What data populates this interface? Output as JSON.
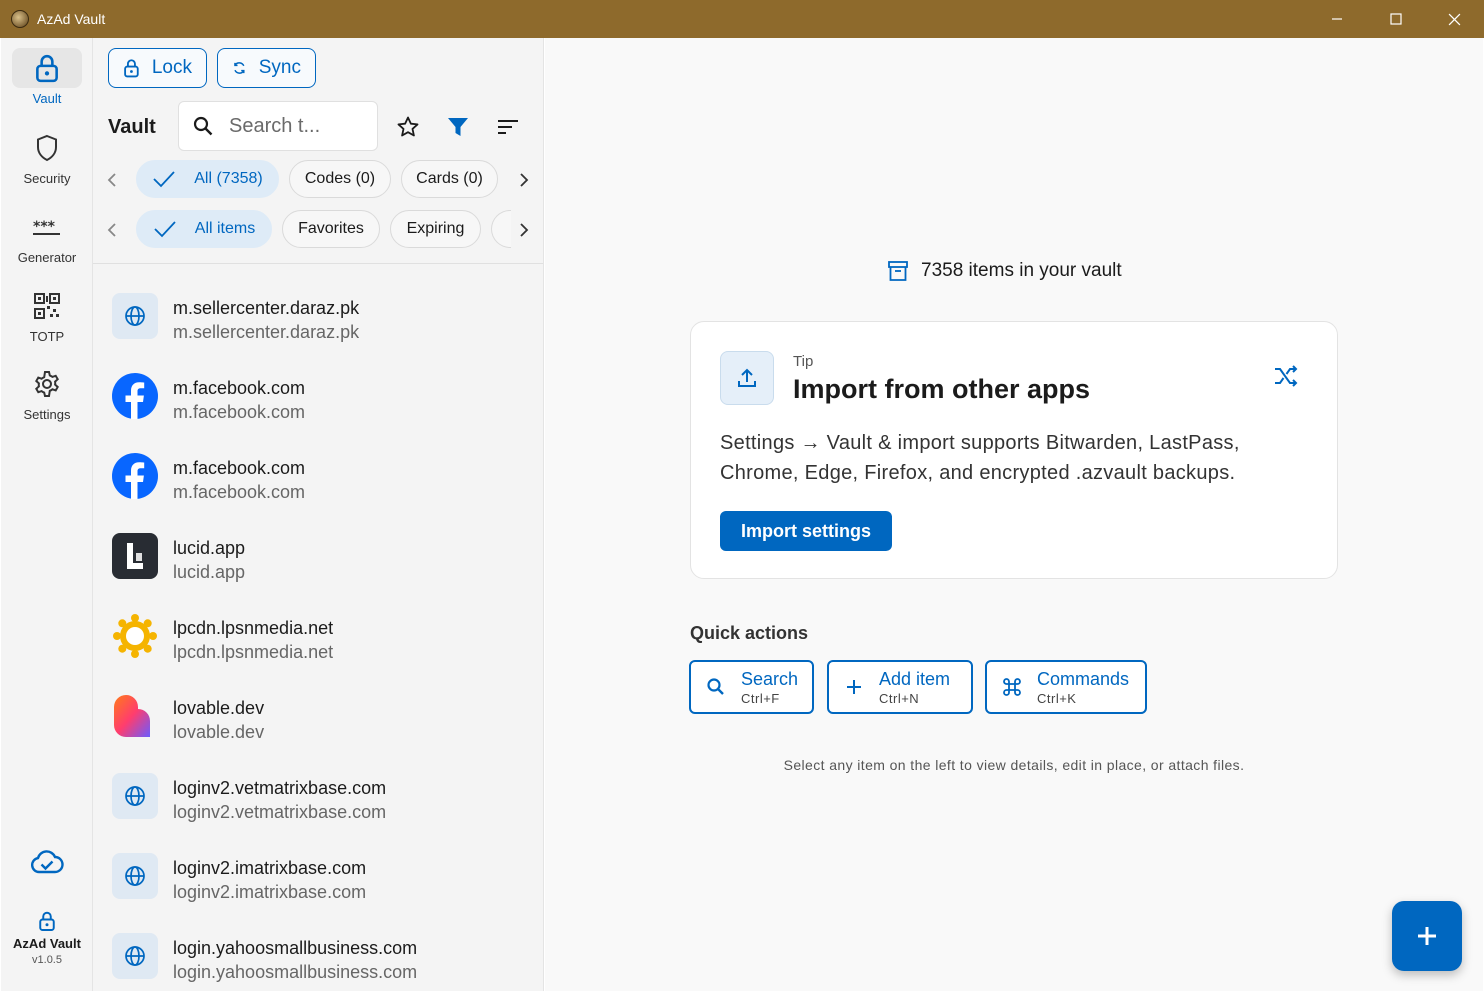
{
  "window": {
    "title": "AzAd Vault"
  },
  "rail": {
    "items": [
      {
        "label": "Vault",
        "icon": "lock-icon",
        "active": true
      },
      {
        "label": "Security",
        "icon": "shield-icon"
      },
      {
        "label": "Generator",
        "icon": "asterisks-icon"
      },
      {
        "label": "TOTP",
        "icon": "qr-code-icon"
      },
      {
        "label": "Settings",
        "icon": "gear-icon"
      }
    ],
    "brand_name": "AzAd Vault",
    "version": "v1.0.5"
  },
  "toolbar": {
    "lock_label": "Lock",
    "sync_label": "Sync"
  },
  "list": {
    "title": "Vault",
    "search_placeholder": "Search t...",
    "type_filters": [
      "All (7358)",
      "Codes (0)",
      "Cards (0)"
    ],
    "view_filters": [
      "All items",
      "Favorites",
      "Expiring"
    ],
    "entries": [
      {
        "name": "m.sellercenter.daraz.pk",
        "sub": "m.sellercenter.daraz.pk",
        "icon": "globe"
      },
      {
        "name": "m.facebook.com",
        "sub": "m.facebook.com",
        "icon": "facebook"
      },
      {
        "name": "m.facebook.com",
        "sub": "m.facebook.com",
        "icon": "facebook"
      },
      {
        "name": "lucid.app",
        "sub": "lucid.app",
        "icon": "lucid"
      },
      {
        "name": "lpcdn.lpsnmedia.net",
        "sub": "lpcdn.lpsnmedia.net",
        "icon": "sun"
      },
      {
        "name": "lovable.dev",
        "sub": "lovable.dev",
        "icon": "heart"
      },
      {
        "name": "loginv2.vetmatrixbase.com",
        "sub": "loginv2.vetmatrixbase.com",
        "icon": "globe"
      },
      {
        "name": "loginv2.imatrixbase.com",
        "sub": "loginv2.imatrixbase.com",
        "icon": "globe"
      },
      {
        "name": "login.yahoosmallbusiness.com",
        "sub": "login.yahoosmallbusiness.com",
        "icon": "globe"
      }
    ]
  },
  "detail": {
    "count_text": "7358 items in your vault",
    "tip": {
      "label": "Tip",
      "title": "Import from other apps",
      "body": "Settings → Vault & import supports Bitwarden, LastPass, Chrome, Edge, Firefox, and encrypted .azvault backups.",
      "button": "Import settings"
    },
    "quick_actions_title": "Quick actions",
    "quick_actions": [
      {
        "label": "Search",
        "shortcut": "Ctrl+F"
      },
      {
        "label": "Add item",
        "shortcut": "Ctrl+N"
      },
      {
        "label": "Commands",
        "shortcut": "Ctrl+K"
      }
    ],
    "hint": "Select any item on the left to view details, edit in place, or attach files."
  },
  "colors": {
    "accent": "#0067c0",
    "titlebar": "#8e6a2c"
  }
}
